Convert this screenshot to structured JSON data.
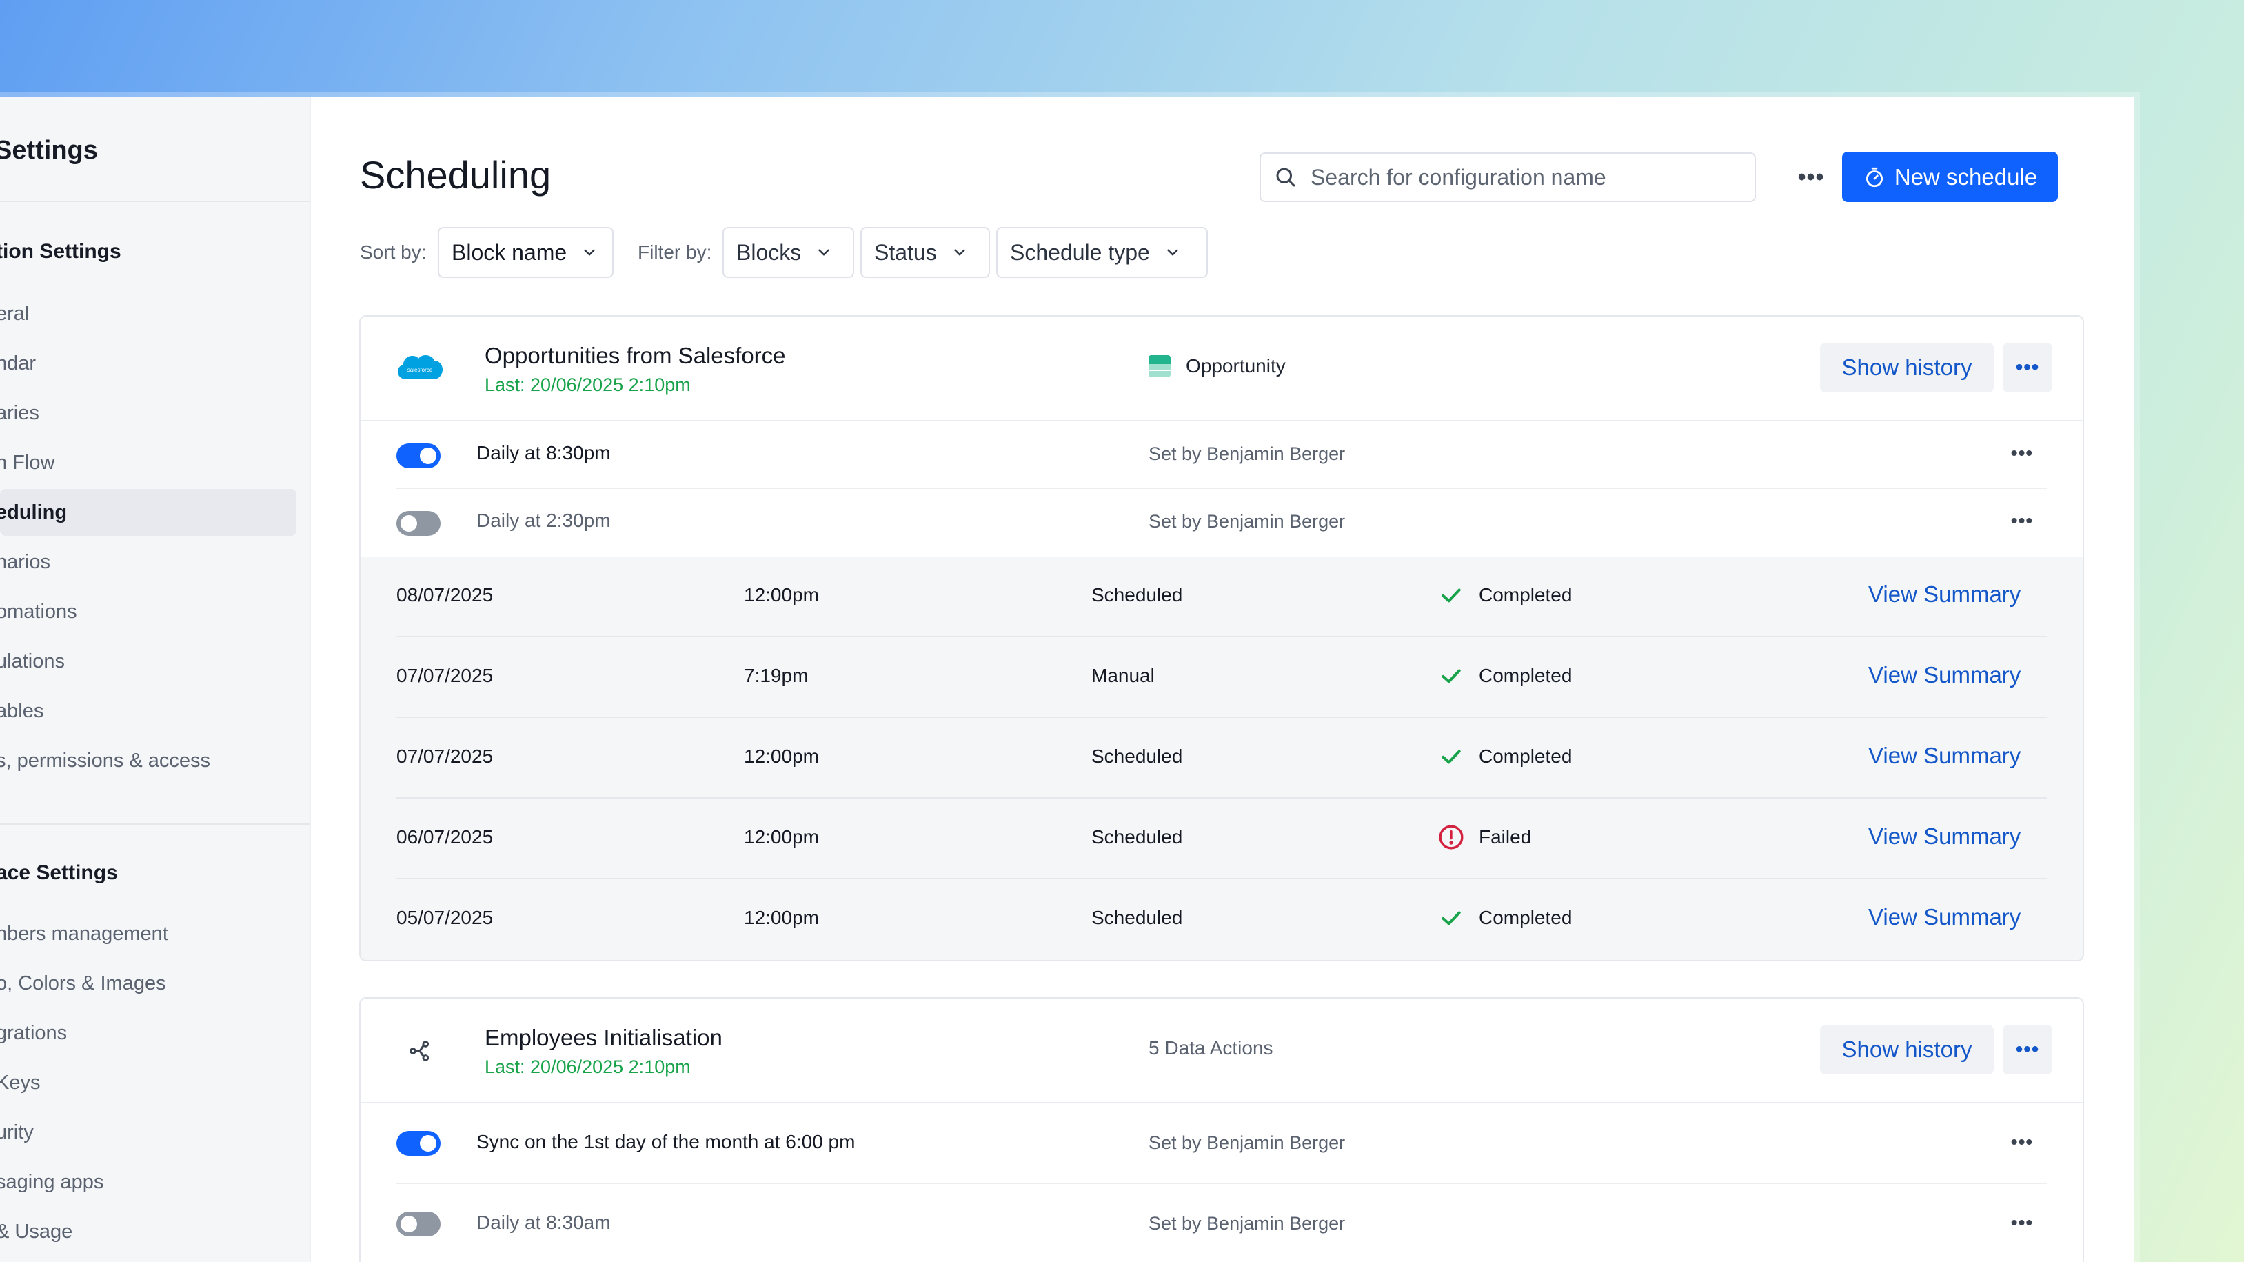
{
  "sidebar": {
    "title": "Settings",
    "section1": "tion Settings",
    "items1": [
      "eral",
      "ndar",
      "aries",
      "n Flow",
      "eduling",
      "narios",
      "omations",
      "ulations",
      "ables",
      "s, permissions & access"
    ],
    "section2": "ace Settings",
    "items2": [
      "nbers management",
      "o, Colors & Images",
      "grations",
      "Keys",
      "urity",
      "saging apps",
      "& Usage"
    ]
  },
  "header": {
    "title": "Scheduling",
    "search_placeholder": "Search for configuration name",
    "more": "•••",
    "new_schedule": "New schedule"
  },
  "filters": {
    "sort_label": "Sort by:",
    "sort_value": "Block name",
    "filter_label": "Filter by:",
    "blocks": "Blocks",
    "status": "Status",
    "schedule_type": "Schedule type"
  },
  "cards": [
    {
      "name": "Opportunities from Salesforce",
      "last": "Last: 20/06/2025 2:10pm",
      "meta": "Opportunity",
      "show_history": "Show history",
      "schedules": [
        {
          "label": "Daily at 8:30pm",
          "by": "Set by Benjamin Berger",
          "enabled": true
        },
        {
          "label": "Daily at 2:30pm",
          "by": "Set by Benjamin Berger",
          "enabled": false
        }
      ],
      "history": [
        {
          "date": "08/07/2025",
          "time": "12:00pm",
          "type": "Scheduled",
          "status": "Completed",
          "link": "View Summary"
        },
        {
          "date": "07/07/2025",
          "time": "7:19pm",
          "type": "Manual",
          "status": "Completed",
          "link": "View Summary"
        },
        {
          "date": "07/07/2025",
          "time": "12:00pm",
          "type": "Scheduled",
          "status": "Completed",
          "link": "View Summary"
        },
        {
          "date": "06/07/2025",
          "time": "12:00pm",
          "type": "Scheduled",
          "status": "Failed",
          "link": "View Summary"
        },
        {
          "date": "05/07/2025",
          "time": "12:00pm",
          "type": "Scheduled",
          "status": "Completed",
          "link": "View Summary"
        }
      ]
    },
    {
      "name": "Employees Initialisation",
      "last": "Last: 20/06/2025 2:10pm",
      "meta": "5 Data Actions",
      "show_history": "Show history",
      "schedules": [
        {
          "label": "Sync on the 1st day of the month at 6:00 pm",
          "by": "Set by Benjamin Berger",
          "enabled": true
        },
        {
          "label": "Daily at 8:30am",
          "by": "Set by Benjamin Berger",
          "enabled": false
        }
      ]
    }
  ],
  "colors": {
    "accent": "#0f62fe",
    "link": "#1357c9",
    "success": "#18a34a",
    "error": "#d3213f"
  },
  "icons": {
    "salesforce": "salesforce-logo",
    "opportunity": "table-icon",
    "data_actions": "branch-icon"
  }
}
